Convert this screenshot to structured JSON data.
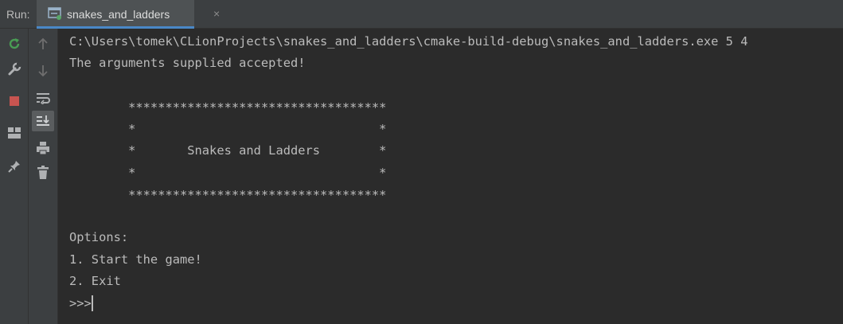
{
  "run_panel": {
    "label": "Run:",
    "tab": {
      "label": "snakes_and_ladders",
      "close": "×"
    }
  },
  "console": {
    "lines": [
      "C:\\Users\\tomek\\CLionProjects\\snakes_and_ladders\\cmake-build-debug\\snakes_and_ladders.exe 5 4",
      "The arguments supplied accepted!",
      "",
      "        ***********************************",
      "        *                                 *",
      "        *       Snakes and Ladders        *",
      "        *                                 *",
      "        ***********************************",
      "",
      "Options:",
      "1. Start the game!",
      "2. Exit",
      ">>>"
    ]
  },
  "toolbar_left": [
    "rerun-icon",
    "wrench-icon",
    "stop-icon",
    "layout-icon",
    "pin-icon"
  ],
  "toolbar_right": [
    "up-arrow-icon",
    "down-arrow-icon",
    "soft-wrap-icon",
    "scroll-to-end-icon",
    "print-icon",
    "trash-icon"
  ],
  "colors": {
    "background": "#2b2b2b",
    "panel": "#3c3f41",
    "text": "#bbbbbb",
    "accent": "#4a88c7",
    "stop": "#c75450",
    "rerun": "#499c54"
  }
}
